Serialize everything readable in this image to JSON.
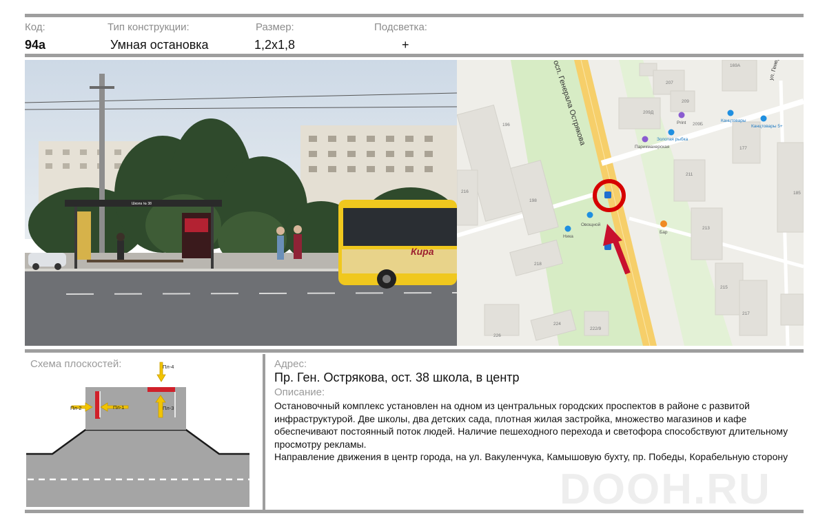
{
  "header": {
    "code_label": "Код:",
    "code_value": "94а",
    "type_label": "Тип конструкции:",
    "type_value": "Умная остановка",
    "size_label": "Размер:",
    "size_value": "1,2х1,8",
    "light_label": "Подсветка:",
    "light_value": "+"
  },
  "photo": {
    "shelter_sign": "Школа № 38",
    "bus_ad": "Кира"
  },
  "map": {
    "street_main": "осп. Генерала Острякова",
    "street_side": "ул. Генерала",
    "buildings": [
      "169А",
      "207",
      "209",
      "209Б",
      "209Д",
      "196",
      "177",
      "185",
      "198",
      "211",
      "213",
      "215",
      "217",
      "218",
      "216",
      "224",
      "222/9",
      "226"
    ],
    "pois": [
      "Print",
      "Канцтовары",
      "Канцтовары 5+",
      "Золотая рыбка",
      "Парикмахерская",
      "Овощной",
      "Ника",
      "Бар"
    ]
  },
  "schema": {
    "title": "Схема плоскостей:",
    "planes": [
      "Пл-1",
      "Пл-2",
      "Пл-3",
      "Пл-4"
    ]
  },
  "details": {
    "address_label": "Адрес:",
    "address": "Пр. Ген. Острякова,  ост. 38 школа,  в центр",
    "desc_label": "Описание:",
    "desc_p1": "Остановочный комплекс установлен на одном из центральных городских проспектов в районе с развитой инфраструктурой. Две школы, два детских сада, плотная жилая застройка, множество магазинов и кафе обеспечивают постоянный поток людей. Наличие пешеходного перехода и светофора способствуют длительному просмотру рекламы.",
    "desc_p2": "Направление движения в центр города, на ул. Вакуленчука, Камышовую бухту, пр. Победы, Корабельную сторону"
  },
  "watermark": "DOOH.RU",
  "colors": {
    "divider": "#9e9e9e",
    "plane_red": "#d0202a",
    "arrow_yellow": "#f2c400",
    "road": "#a8a8a8",
    "map_marker": "#d60000"
  }
}
